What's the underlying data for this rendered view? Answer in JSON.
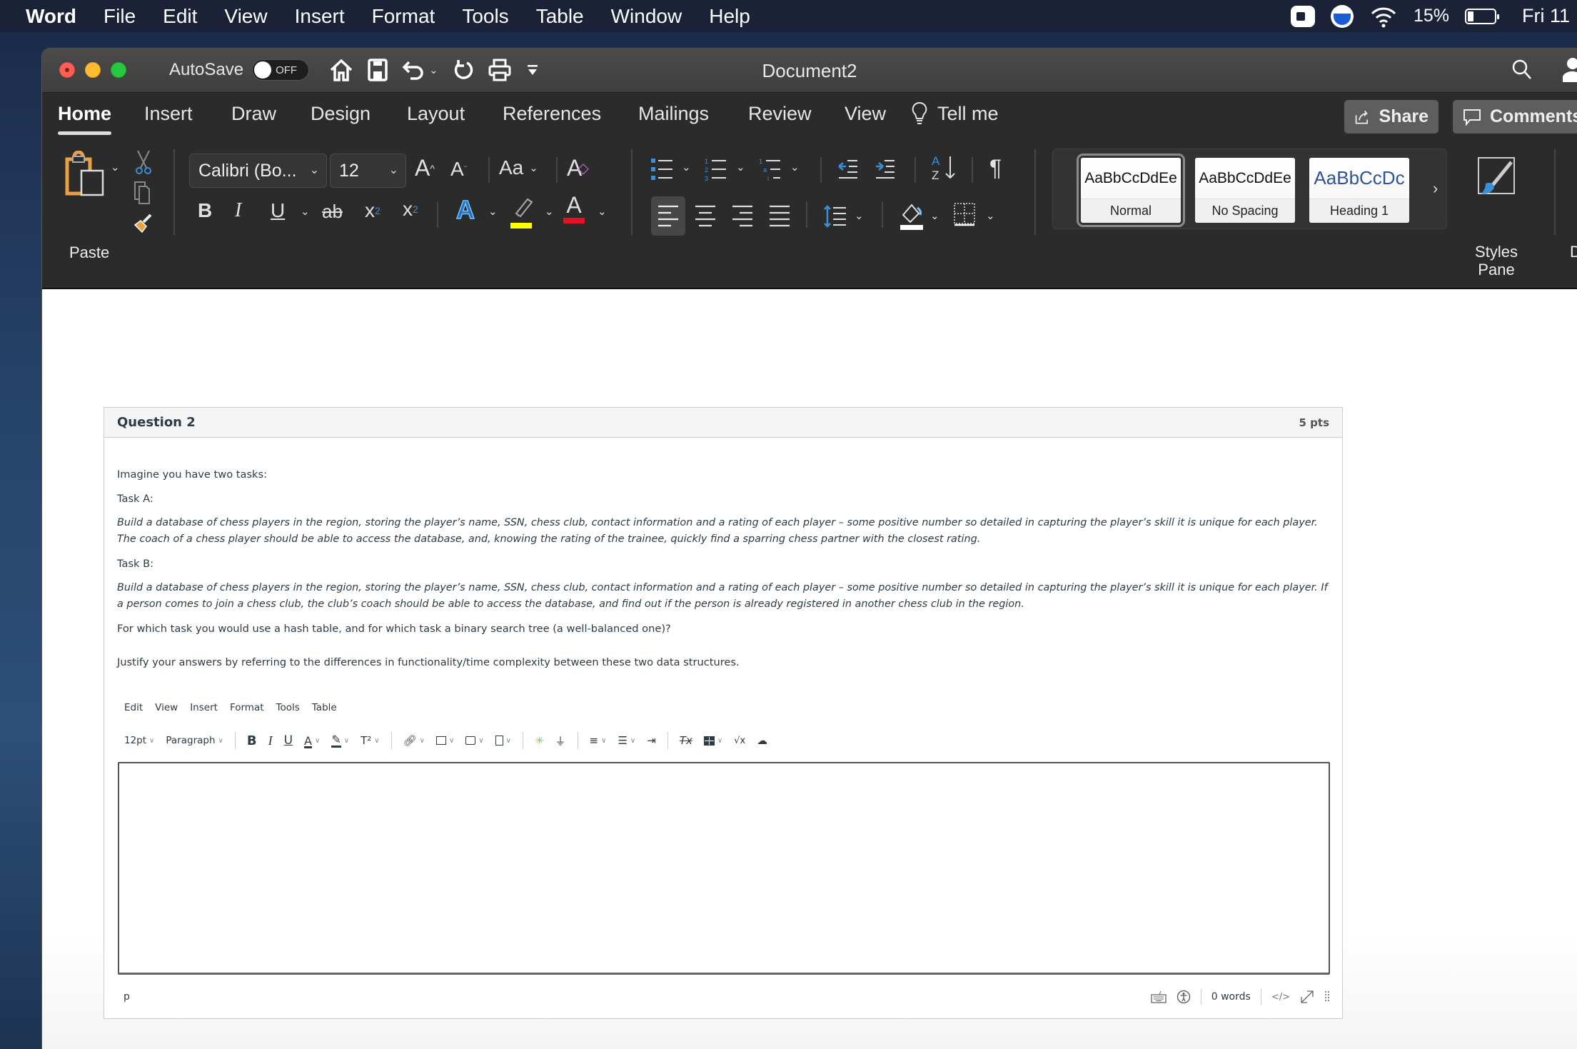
{
  "system_menubar": {
    "app_name": "Word",
    "items": [
      "File",
      "Edit",
      "View",
      "Insert",
      "Format",
      "Tools",
      "Table",
      "Window",
      "Help"
    ],
    "battery_percent": "15%",
    "clock": "Fri 11"
  },
  "window": {
    "title": "Document2",
    "autosave_label": "AutoSave",
    "autosave_state": "OFF"
  },
  "ribbon_tabs": [
    "Home",
    "Insert",
    "Draw",
    "Design",
    "Layout",
    "References",
    "Mailings",
    "Review",
    "View"
  ],
  "active_tab": "Home",
  "tell_me": "Tell me",
  "share_label": "Share",
  "comments_label": "Comments",
  "ribbon": {
    "paste_label": "Paste",
    "font_name": "Calibri (Bo...",
    "font_size": "12",
    "change_case": "Aa",
    "styles": [
      {
        "sample": "AaBbCcDdEe",
        "name": "Normal"
      },
      {
        "sample": "AaBbCcDdEe",
        "name": "No Spacing"
      },
      {
        "sample": "AaBbCcDc",
        "name": "Heading 1"
      }
    ],
    "styles_pane_label": "Styles Pane",
    "styles_pane_l1": "Styles",
    "styles_pane_l2": "Pane",
    "dictate_label": "Dictate",
    "highlight_color": "#ffff00",
    "font_color": "#e81123",
    "accent_blue": "#3a8fd9"
  },
  "question": {
    "title": "Question 2",
    "points": "5 pts",
    "paragraphs": [
      {
        "text": "Imagine you have two tasks:",
        "italic": false
      },
      {
        "text": "Task A:",
        "italic": false
      },
      {
        "text": "Build a database of chess players in the region, storing the player’s name, SSN, chess club, contact information and a rating of each player – some positive number so detailed in capturing the player’s skill it is unique for each player. The coach of a chess player should be able to access the database, and, knowing the rating of the trainee, quickly find a sparring chess partner with the closest rating.",
        "italic": true
      },
      {
        "text": "Task B:",
        "italic": false
      },
      {
        "text": "Build a database of chess players in the region, storing the player’s name, SSN, chess club, contact information and a rating of each player – some positive number so detailed in capturing the player’s skill it is unique for each player. If a person comes to join a chess club, the club’s coach should be able to access the database, and find out if the person is already registered in another chess club in the region.",
        "italic": true
      },
      {
        "text": "For which task you would use a hash table, and for which task a binary search tree (a well-balanced one)?",
        "italic": false
      },
      {
        "text": "Justify your answers by referring to the differences in functionality/time complexity between these two data structures.",
        "italic": false
      }
    ]
  },
  "editor": {
    "menu": [
      "Edit",
      "View",
      "Insert",
      "Format",
      "Tools",
      "Table"
    ],
    "font_size": "12pt",
    "block_format": "Paragraph",
    "content": "",
    "status_path": "p",
    "word_count": "0 words",
    "html_toggle": "</>"
  }
}
